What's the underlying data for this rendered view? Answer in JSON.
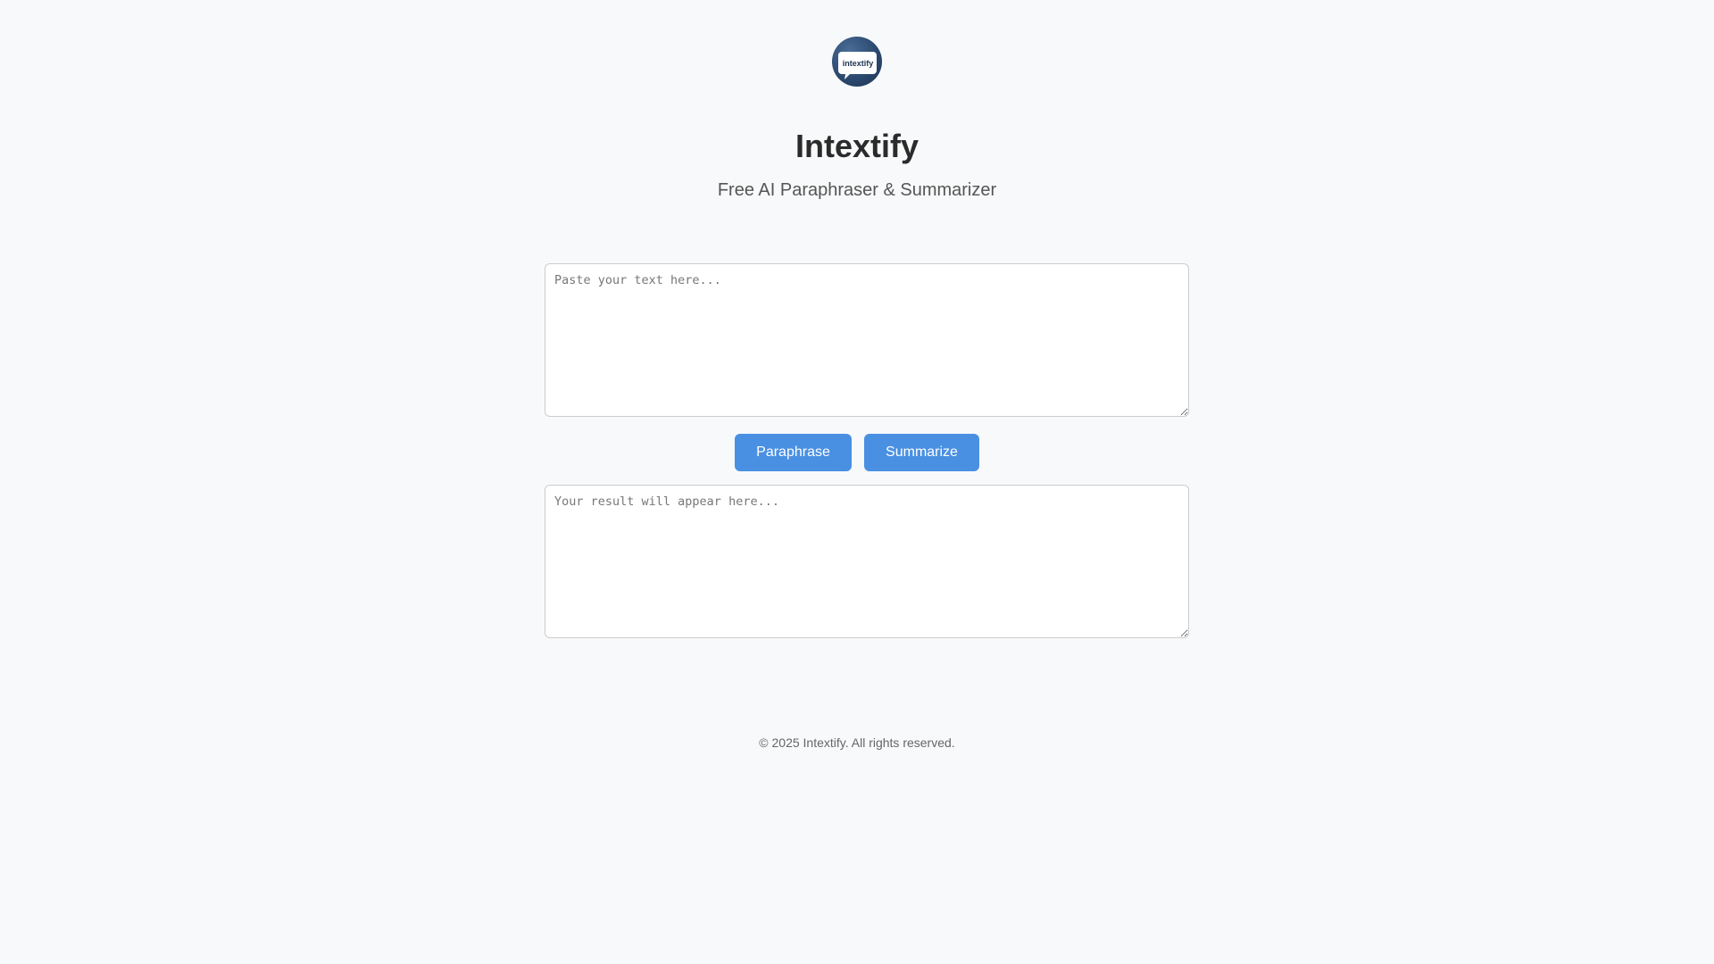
{
  "header": {
    "logo_text": "intextify",
    "title": "Intextify",
    "subtitle": "Free AI Paraphraser & Summarizer"
  },
  "main": {
    "input": {
      "value": "",
      "placeholder": "Paste your text here..."
    },
    "actions": {
      "paraphrase_label": "Paraphrase",
      "summarize_label": "Summarize"
    },
    "output": {
      "value": "",
      "placeholder": "Your result will appear here..."
    }
  },
  "footer": {
    "copyright": "© 2025 Intextify. All rights reserved."
  },
  "colors": {
    "background": "#f8f9fa",
    "accent": "#4a90e2",
    "logo_dark": "#1d3352"
  },
  "icons": {
    "logo": "speech-bubble-logo-icon"
  }
}
